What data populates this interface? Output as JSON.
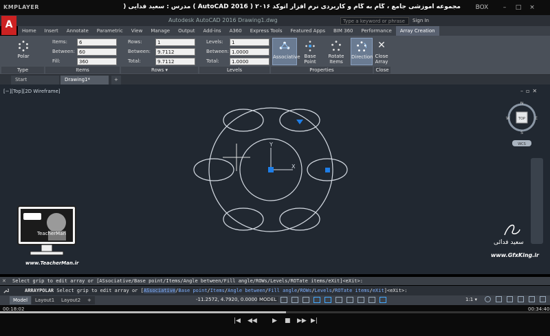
{
  "player": {
    "logo": "KMPLAYER",
    "caption": "مجموعه آموزشی جامع ، گام به گام و کاربردی نرم افزار اتوکد ۲۰۱۶ ( AutoCAD 2016 ) مدرس : سعید فدایی (تیچرمن) گروه آموزشی پادشاه گرافیست ها",
    "buttons": {
      "box": "BOX",
      "minimize": "–",
      "maximize": "□",
      "close": "×"
    },
    "time_current": "00:18:02",
    "time_total": "00:34:40",
    "progress": 0.52,
    "controls": [
      "|◀",
      "◀◀",
      "▶",
      "■",
      "▶▶",
      "▶|"
    ]
  },
  "acad": {
    "logo": "A",
    "window_title": "Autodesk AutoCAD 2016   Drawing1.dwg",
    "search_placeholder": "Type a keyword or phrase",
    "signin": "Sign In",
    "tabs": [
      "Home",
      "Insert",
      "Annotate",
      "Parametric",
      "View",
      "Manage",
      "Output",
      "Add-ins",
      "A360",
      "Express Tools",
      "Featured Apps",
      "BIM 360",
      "Performance",
      "Array Creation"
    ],
    "active_tab": "Array Creation"
  },
  "ribbon": {
    "type": {
      "button": "Polar",
      "title": "Type"
    },
    "items": {
      "title": "Items",
      "items_label": "Items:",
      "items_value": "6",
      "between_label": "Between:",
      "between_value": "60",
      "fill_label": "Fill:",
      "fill_value": "360"
    },
    "rows": {
      "title": "Rows ▾",
      "rows_label": "Rows:",
      "rows_value": "1",
      "between_label": "Between:",
      "between_value": "9.7112",
      "total_label": "Total:",
      "total_value": "9.7112"
    },
    "levels": {
      "title": "Levels",
      "levels_label": "Levels:",
      "levels_value": "1",
      "between_label": "Between:",
      "between_value": "1.0000",
      "total_label": "Total:",
      "total_value": "1.0000"
    },
    "properties": {
      "title": "Properties",
      "associative": "Associative",
      "base_point": "Base Point",
      "rotate_items": "Rotate Items",
      "direction": "Direction"
    },
    "close": {
      "button_line1": "Close",
      "button_line2": "Array",
      "title": "Close"
    }
  },
  "doc_tabs": {
    "start": "Start",
    "drawing": "Drawing1*",
    "add": "+"
  },
  "viewport": {
    "label": "[−][Top][2D Wireframe]",
    "viewcube": {
      "n": "N",
      "s": "S",
      "e": "E",
      "w": "W",
      "top": "TOP",
      "wcs": "WCS"
    }
  },
  "overlay": {
    "brand_text": "TeacherMan",
    "brand_url": "www.TeacherMan.ir",
    "sign_name": "سعید فدائی",
    "sign_url": "www.GfxKing.ir"
  },
  "command": {
    "history": "Select grip to edit array or [ASsociative/Base point/Items/Angle between/Fill angle/ROWs/Levels/ROTate items/eXit]<eXit>:",
    "prompt_name": "ARRAYPOLAR",
    "prompt_pre": " Select grip to edit array or [",
    "opts": [
      "ASsociative",
      "Base point",
      "Items",
      "Angle between",
      "Fill angle",
      "ROWs",
      "Levels",
      "ROTate items",
      "eXit"
    ],
    "prompt_post": "]<eXit>:"
  },
  "status": {
    "model_tab": "Model",
    "layout1": "Layout1",
    "layout2": "Layout2",
    "add": "+",
    "coords": "-11.2572, 4.7920, 0.0000",
    "model_label": "MODEL",
    "scale": "1:1 ▾"
  },
  "colors": {
    "accent": "#c22222",
    "grip": "#1e7ee8",
    "canvas": "#212831"
  }
}
